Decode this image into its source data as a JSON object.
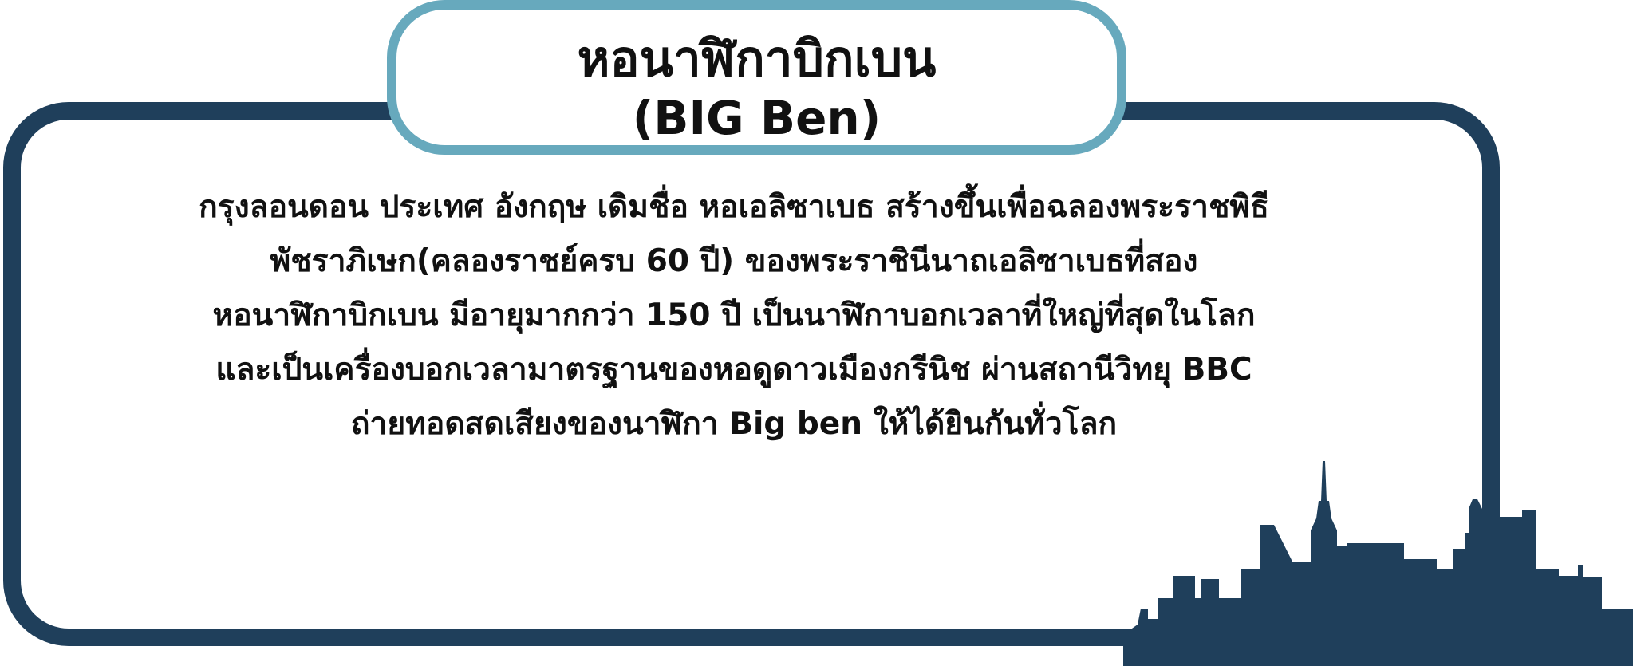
{
  "title": {
    "main": "หอนาฬิกาบิกเบน",
    "sub": "(BIG Ben)"
  },
  "body": {
    "lines": [
      "กรุงลอนดอน ประเทศ อังกฤษ เดิมชื่อ หอเอลิซาเบธ สร้างขึ้นเพื่อฉลองพระราชพิธี",
      "พัชราภิเษก(คลองราชย์ครบ 60 ปี) ของพระราชินีนาถเอลิซาเบธที่สอง",
      "หอนาฬิกาบิกเบน มีอายุมากกว่า 150 ปี เป็นนาฬิกาบอกเวลาที่ใหญ่ที่สุดในโลก",
      "และเป็นเครื่องบอกเวลามาตรฐานของหอดูดาวเมืองกรีนิช ผ่านสถานีวิทยุ BBC",
      "ถ่ายทอดสดเสียงของนาฬิกา Big ben ให้ได้ยินกันทั่วโลก"
    ]
  },
  "colors": {
    "frame": "#1f3f5b",
    "title_border": "#67a9bd",
    "skyline": "#1f3f5b",
    "text": "#111111",
    "background": "#ffffff"
  },
  "icons": {
    "skyline": "city-skyline-icon"
  }
}
